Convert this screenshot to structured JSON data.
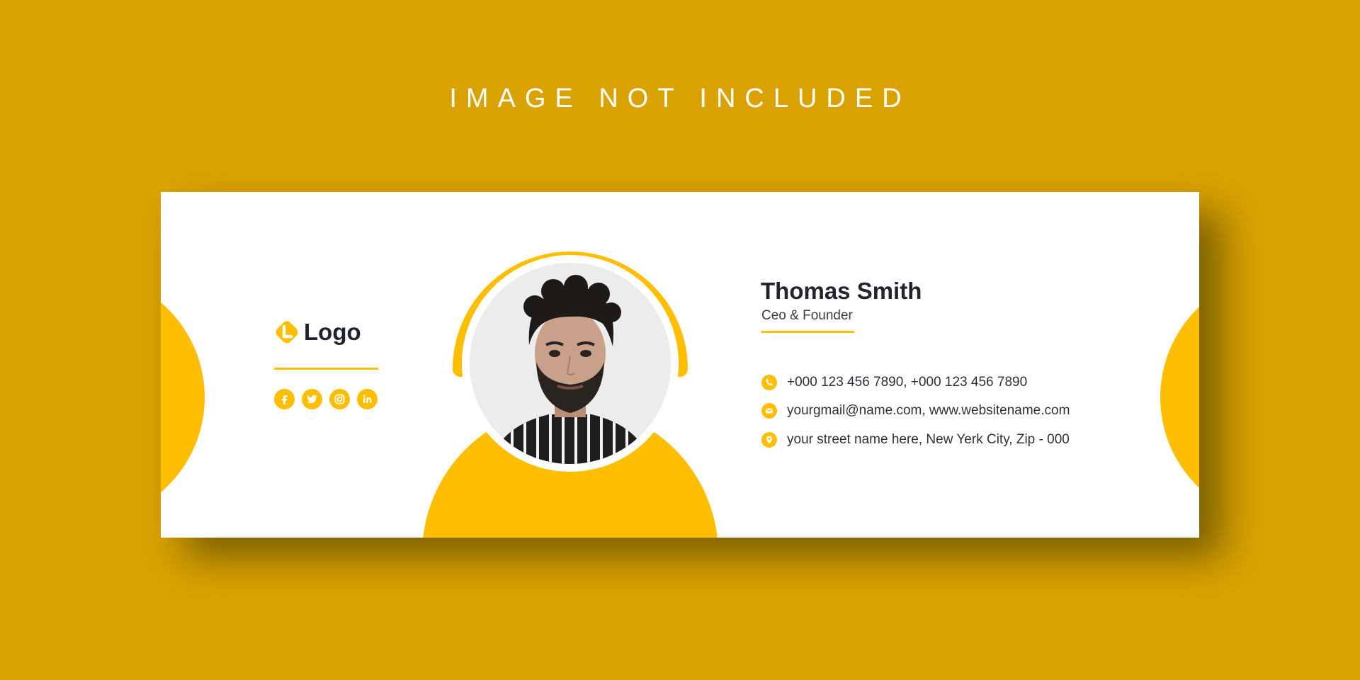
{
  "banner": {
    "text": "IMAGE NOT INCLUDED"
  },
  "logo": {
    "text": "Logo",
    "mark_letter": "L"
  },
  "socials": [
    {
      "icon": "facebook-icon"
    },
    {
      "icon": "twitter-icon"
    },
    {
      "icon": "instagram-icon"
    },
    {
      "icon": "linkedin-icon"
    }
  ],
  "profile": {
    "name": "Thomas Smith",
    "role": "Ceo & Founder"
  },
  "contacts": [
    {
      "icon": "phone-icon",
      "text": "+000 123 456 7890, +000 123 456 7890"
    },
    {
      "icon": "email-icon",
      "text": "yourgmail@name.com, www.websitename.com"
    },
    {
      "icon": "location-icon",
      "text": "your street name here, New Yerk City, Zip - 000"
    }
  ],
  "colors": {
    "background": "#D9A200",
    "accent": "#FFBE00",
    "card": "#FFFFFF",
    "text_dark": "#22252F"
  }
}
